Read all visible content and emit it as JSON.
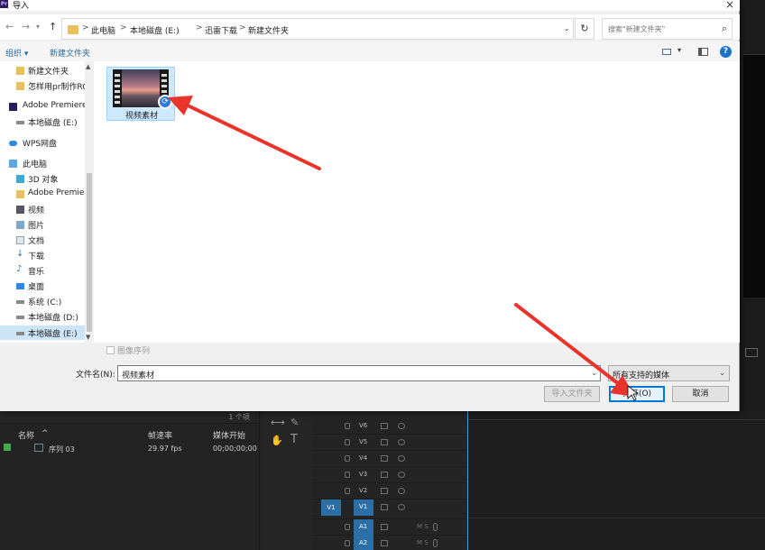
{
  "dialog": {
    "title": "导入",
    "close": "×",
    "back": "←",
    "forward": "→",
    "up": "↑",
    "breadcrumbs": [
      "此电脑",
      "本地磁盘 (E:)",
      "迅雷下载",
      "新建文件夹"
    ],
    "crumb_separator": ">",
    "search_placeholder": "搜索\"新建文件夹\"",
    "toolbar": {
      "organize": "组织 ▾",
      "new_folder": "新建文件夹",
      "help": "?"
    },
    "nav_items": [
      {
        "label": "新建文件夹",
        "icon": "folder-icon"
      },
      {
        "label": "怎样用pr制作RC",
        "icon": "folder-icon"
      },
      {
        "label": "Adobe Premiere",
        "icon": "premiere-icon"
      },
      {
        "label": "本地磁盘 (E:)",
        "icon": "drive-icon"
      },
      {
        "label": "WPS网盘",
        "icon": "cloud-icon"
      },
      {
        "label": "此电脑",
        "icon": "computer-icon"
      },
      {
        "label": "3D 对象",
        "icon": "3d-objects-icon"
      },
      {
        "label": "Adobe Premier",
        "icon": "folder-icon"
      },
      {
        "label": "视频",
        "icon": "video-icon"
      },
      {
        "label": "图片",
        "icon": "picture-icon"
      },
      {
        "label": "文档",
        "icon": "document-icon"
      },
      {
        "label": "下载",
        "icon": "download-icon"
      },
      {
        "label": "音乐",
        "icon": "music-icon"
      },
      {
        "label": "桌面",
        "icon": "desktop-icon"
      },
      {
        "label": "系统 (C:)",
        "icon": "drive-icon"
      },
      {
        "label": "本地磁盘 (D:)",
        "icon": "drive-icon"
      },
      {
        "label": "本地磁盘 (E:)",
        "icon": "drive-icon"
      }
    ],
    "file": {
      "name": "视频素材",
      "icon": "video-file-icon"
    },
    "image_sequence": "图像序列",
    "filename_label": "文件名(N):",
    "filename_value": "视频素材",
    "filter_value": "所有支持的媒体",
    "import_folder": "导入文件夹",
    "open": "打开(O)",
    "cancel": "取消"
  },
  "premiere": {
    "project_count": "1 个项",
    "columns": {
      "name": "名称",
      "framerate": "帧速率",
      "media_start": "媒体开始"
    },
    "sequence": {
      "name": "序列 03",
      "framerate": "29.97 fps",
      "media_start": "00;00;00;00"
    },
    "video_tracks": [
      "V6",
      "V5",
      "V4",
      "V3",
      "V2",
      "V1"
    ],
    "audio_tracks": [
      "A1",
      "A2"
    ],
    "source_track": "V1",
    "type_tool": "T"
  },
  "colors": {
    "accent": "#0078d7",
    "annotation_arrow": "#e8342b",
    "track_blue": "#2c6fa6",
    "label_green": "#3fae49"
  }
}
